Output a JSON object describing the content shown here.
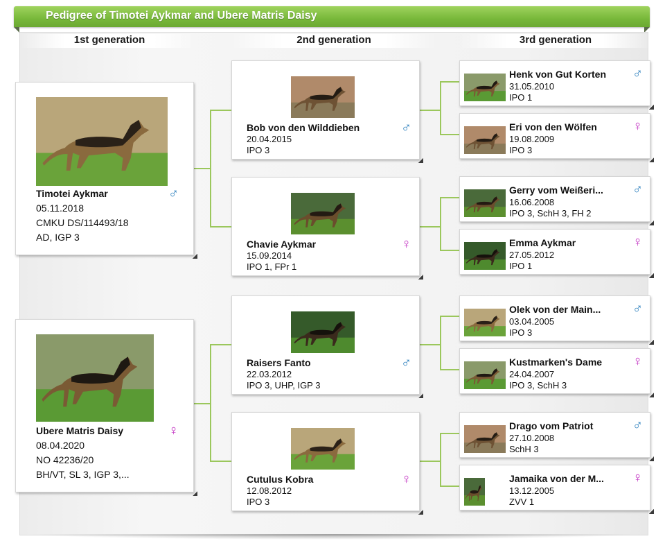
{
  "title": "Pedigree of Timotei Aykmar and Ubere Matris Daisy",
  "headers": [
    "1st generation",
    "2nd generation",
    "3rd generation"
  ],
  "gen1": [
    {
      "name": "Timotei Aykmar",
      "lines": [
        "05.11.2018",
        "CMKU DS/114493/18",
        "AD, IGP 3"
      ],
      "sex": "male"
    },
    {
      "name": "Ubere Matris Daisy",
      "lines": [
        "08.04.2020",
        "NO 42236/20",
        "BH/VT, SL 3, IGP 3,..."
      ],
      "sex": "female"
    }
  ],
  "gen2": [
    {
      "name": "Bob von den Wilddieben",
      "lines": [
        "20.04.2015",
        "IPO 3"
      ],
      "sex": "male"
    },
    {
      "name": "Chavie Aykmar",
      "lines": [
        "15.09.2014",
        "IPO 1, FPr 1"
      ],
      "sex": "female"
    },
    {
      "name": "Raisers Fanto",
      "lines": [
        "22.03.2012",
        "IPO 3, UHP, IGP 3"
      ],
      "sex": "male"
    },
    {
      "name": "Cutulus Kobra",
      "lines": [
        "12.08.2012",
        "IPO 3"
      ],
      "sex": "female"
    }
  ],
  "gen3": [
    {
      "name": "Henk von Gut Korten",
      "lines": [
        "31.05.2010",
        "IPO 1"
      ],
      "sex": "male"
    },
    {
      "name": "Eri von den Wölfen",
      "lines": [
        "19.08.2009",
        "IPO 3"
      ],
      "sex": "female"
    },
    {
      "name": "Gerry vom Weißeri...",
      "lines": [
        "16.06.2008",
        "IPO 3, SchH 3, FH 2"
      ],
      "sex": "male"
    },
    {
      "name": "Emma Aykmar",
      "lines": [
        "27.05.2012",
        "IPO 1"
      ],
      "sex": "female"
    },
    {
      "name": "Olek von der Main...",
      "lines": [
        "03.04.2005",
        "IPO 3"
      ],
      "sex": "male"
    },
    {
      "name": "Kustmarken's Dame",
      "lines": [
        "24.04.2007",
        "IPO 3, SchH 3"
      ],
      "sex": "female"
    },
    {
      "name": "Drago vom Patriot",
      "lines": [
        "27.10.2008",
        "SchH 3"
      ],
      "sex": "male"
    },
    {
      "name": "Jamaika von der M...",
      "lines": [
        "13.12.2005",
        "ZVV 1"
      ],
      "sex": "female"
    }
  ],
  "sex_symbols": {
    "male": "♂",
    "female": "♀"
  },
  "colors": {
    "accent": "#78b83a",
    "connector": "#9bc75c",
    "male": "#2b7fbd",
    "female": "#c333c3"
  },
  "icons": {
    "male": "male-symbol-icon",
    "female": "female-symbol-icon",
    "photo": "dog-photo"
  }
}
